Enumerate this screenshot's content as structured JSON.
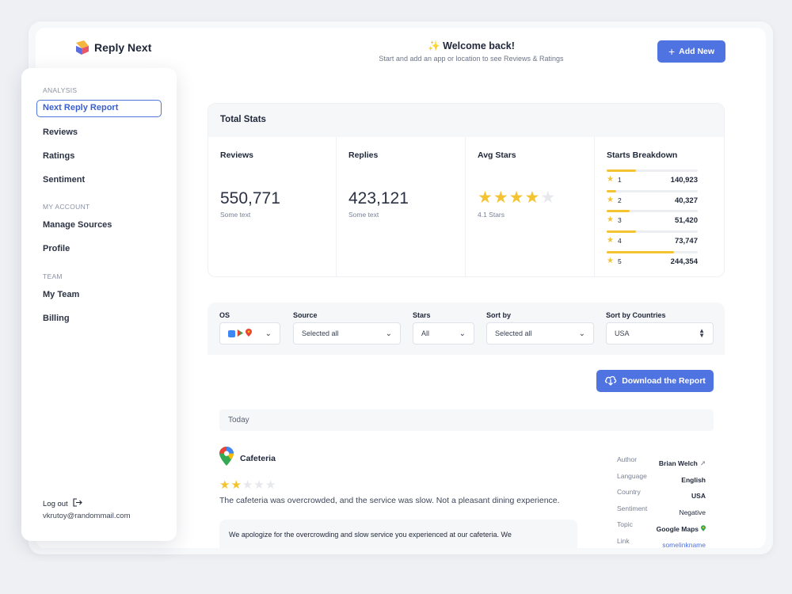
{
  "brand": {
    "name": "Reply Next"
  },
  "header": {
    "welcome_title": "Welcome back!",
    "welcome_subtitle": "Start and add an app or location to see Reviews & Ratings",
    "add_button": "Add New"
  },
  "sidebar": {
    "sections": [
      {
        "title": "ANALYSIS",
        "items": [
          "Next Reply Report",
          "Reviews",
          "Ratings",
          "Sentiment"
        ]
      },
      {
        "title": "MY ACCOUNT",
        "items": [
          "Manage Sources",
          "Profile"
        ]
      },
      {
        "title": "TEAM",
        "items": [
          "My Team",
          "Billing"
        ]
      }
    ],
    "active_item": "Next Reply Report",
    "logout": "Log out",
    "email": "vkrutoy@randommail.com"
  },
  "stats": {
    "title": "Total Stats",
    "reviews": {
      "label": "Reviews",
      "value": "550,771",
      "sub": "Some text"
    },
    "replies": {
      "label": "Replies",
      "value": "423,121",
      "sub": "Some text"
    },
    "avg": {
      "label": "Avg Stars",
      "rating": 4.1,
      "sub": "4.1 Stars"
    },
    "breakdown": {
      "label": "Starts Breakdown",
      "rows": [
        {
          "star": "1",
          "value": "140,923",
          "fill": 0.32
        },
        {
          "star": "2",
          "value": "40,327",
          "fill": 0.1
        },
        {
          "star": "3",
          "value": "51,420",
          "fill": 0.25
        },
        {
          "star": "4",
          "value": "73,747",
          "fill": 0.32
        },
        {
          "star": "5",
          "value": "244,354",
          "fill": 0.74
        }
      ]
    }
  },
  "filters": {
    "os": {
      "label": "OS"
    },
    "source": {
      "label": "Source",
      "value": "Selected all"
    },
    "stars": {
      "label": "Stars",
      "value": "All"
    },
    "sort_by": {
      "label": "Sort by",
      "value": "Selected all"
    },
    "countries": {
      "label": "Sort by Countries",
      "value": "USA"
    }
  },
  "download_button": "Download the Report",
  "today_label": "Today",
  "review": {
    "place": "Cafeteria",
    "rating": 2,
    "text": "The cafeteria was overcrowded, and the service was slow. Not a pleasant dining experience.",
    "reply": "We apologize for the overcrowding and slow service you experienced at our cafeteria. We",
    "meta": {
      "author_label": "Author",
      "author": "Brian Welch",
      "language_label": "Language",
      "language": "English",
      "country_label": "Country",
      "country": "USA",
      "sentiment_label": "Sentiment",
      "sentiment": "Negative",
      "topic_label": "Topic",
      "topic": "Google Maps",
      "link_label": "Link",
      "link": "somelinkname"
    }
  },
  "colors": {
    "accent": "#4f73e0",
    "star": "#f4c430"
  }
}
